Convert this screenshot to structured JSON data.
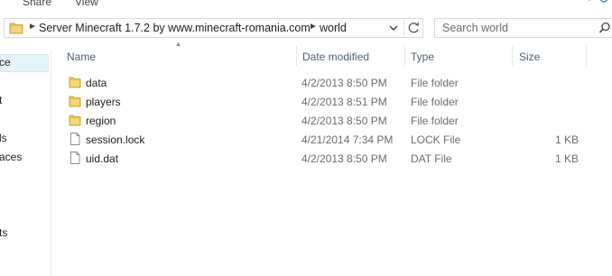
{
  "ribbon": {
    "tabs": [
      "Share",
      "View"
    ]
  },
  "address": {
    "crumbs": [
      "Server Minecraft 1.7.2 by www.minecraft-romania.com",
      "world"
    ]
  },
  "search": {
    "placeholder": "Search world"
  },
  "nav": {
    "items": [
      "ce",
      "t",
      "ls",
      "aces",
      "ts"
    ]
  },
  "columns": {
    "name": "Name",
    "date": "Date modified",
    "type": "Type",
    "size": "Size"
  },
  "files": [
    {
      "name": "data",
      "date": "4/2/2013 8:50 PM",
      "type": "File folder",
      "size": "",
      "icon": "folder-icon"
    },
    {
      "name": "players",
      "date": "4/2/2013 8:51 PM",
      "type": "File folder",
      "size": "",
      "icon": "folder-icon"
    },
    {
      "name": "region",
      "date": "4/2/2013 8:50 PM",
      "type": "File folder",
      "size": "",
      "icon": "folder-icon"
    },
    {
      "name": "session.lock",
      "date": "4/21/2014 7:34 PM",
      "type": "LOCK File",
      "size": "1 KB",
      "icon": "file-icon"
    },
    {
      "name": "uid.dat",
      "date": "4/2/2013 8:50 PM",
      "type": "DAT File",
      "size": "1 KB",
      "icon": "file-icon"
    }
  ],
  "colors": {
    "folder": "#e8c150",
    "header_text": "#4c607a",
    "secondary_text": "#6d6d6d",
    "nav_selected": "#e5f3fb"
  }
}
